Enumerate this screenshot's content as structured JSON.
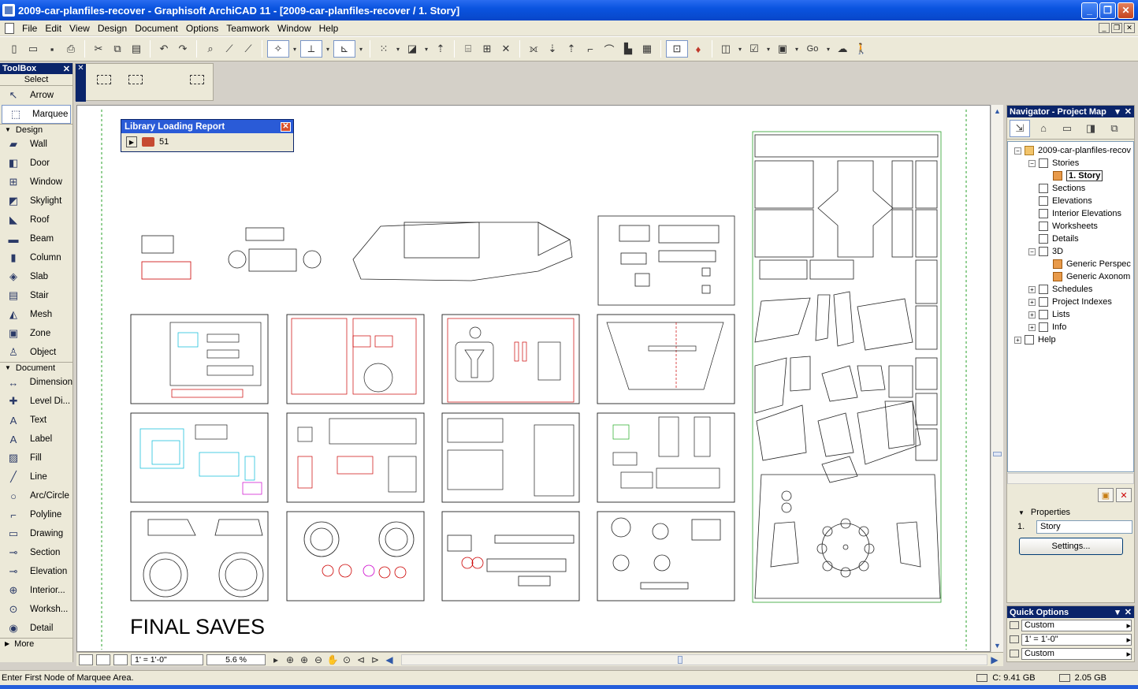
{
  "window": {
    "title": "2009-car-planfiles-recover - Graphisoft ArchiCAD 11 - [2009-car-planfiles-recover / 1. Story]",
    "min": "_",
    "max": "❐",
    "close": "✕"
  },
  "menu": [
    "File",
    "Edit",
    "View",
    "Design",
    "Document",
    "Options",
    "Teamwork",
    "Window",
    "Help"
  ],
  "toolbar": {
    "go_label": "Go"
  },
  "toolbox": {
    "title": "ToolBox",
    "close": "✕",
    "select_label": "Select",
    "select_tools": [
      {
        "label": "Arrow",
        "icon": "arrow-icon",
        "glyph": "↖"
      },
      {
        "label": "Marquee",
        "icon": "marquee-icon",
        "glyph": "⬚",
        "selected": true
      }
    ],
    "design_label": "Design",
    "design_tools": [
      {
        "label": "Wall",
        "icon": "wall-icon",
        "glyph": "▰"
      },
      {
        "label": "Door",
        "icon": "door-icon",
        "glyph": "◧"
      },
      {
        "label": "Window",
        "icon": "window-icon",
        "glyph": "⊞"
      },
      {
        "label": "Skylight",
        "icon": "skylight-icon",
        "glyph": "◩"
      },
      {
        "label": "Roof",
        "icon": "roof-icon",
        "glyph": "◣"
      },
      {
        "label": "Beam",
        "icon": "beam-icon",
        "glyph": "▬"
      },
      {
        "label": "Column",
        "icon": "column-icon",
        "glyph": "▮"
      },
      {
        "label": "Slab",
        "icon": "slab-icon",
        "glyph": "◈"
      },
      {
        "label": "Stair",
        "icon": "stair-icon",
        "glyph": "▤"
      },
      {
        "label": "Mesh",
        "icon": "mesh-icon",
        "glyph": "◭"
      },
      {
        "label": "Zone",
        "icon": "zone-icon",
        "glyph": "▣"
      },
      {
        "label": "Object",
        "icon": "object-icon",
        "glyph": "♙"
      }
    ],
    "document_label": "Document",
    "document_tools": [
      {
        "label": "Dimension",
        "icon": "dimension-icon",
        "glyph": "↔"
      },
      {
        "label": "Level Di...",
        "icon": "level-dimension-icon",
        "glyph": "✚"
      },
      {
        "label": "Text",
        "icon": "text-icon",
        "glyph": "A"
      },
      {
        "label": "Label",
        "icon": "label-icon",
        "glyph": "A"
      },
      {
        "label": "Fill",
        "icon": "fill-icon",
        "glyph": "▨"
      },
      {
        "label": "Line",
        "icon": "line-icon",
        "glyph": "╱"
      },
      {
        "label": "Arc/Circle",
        "icon": "arc-circle-icon",
        "glyph": "○"
      },
      {
        "label": "Polyline",
        "icon": "polyline-icon",
        "glyph": "⌐"
      },
      {
        "label": "Drawing",
        "icon": "drawing-icon",
        "glyph": "▭"
      },
      {
        "label": "Section",
        "icon": "section-icon",
        "glyph": "⊸"
      },
      {
        "label": "Elevation",
        "icon": "elevation-icon",
        "glyph": "⊸"
      },
      {
        "label": "Interior...",
        "icon": "interior-elevation-icon",
        "glyph": "⊕"
      },
      {
        "label": "Worksh...",
        "icon": "worksheet-icon",
        "glyph": "⊙"
      },
      {
        "label": "Detail",
        "icon": "detail-icon",
        "glyph": "◉"
      }
    ],
    "more_label": "More"
  },
  "library_report": {
    "title": "Library Loading Report",
    "count": "51"
  },
  "canvas": {
    "final_text": "FINAL SAVES"
  },
  "bottombar": {
    "scale": "1'    =    1'-0\"",
    "zoom": "5.6 %"
  },
  "status": {
    "message": "Enter First Node of Marquee Area.",
    "disk": "C: 9.41 GB",
    "memory": "2.05 GB"
  },
  "navigator": {
    "title": "Navigator - Project Map",
    "tree": [
      {
        "label": "2009-car-planfiles-recov",
        "level": 0,
        "pm": "−",
        "type": "folder"
      },
      {
        "label": "Stories",
        "level": 1,
        "pm": "−",
        "type": "plain"
      },
      {
        "label": "1. Story",
        "level": 2,
        "pm": "",
        "type": "story",
        "selected": true
      },
      {
        "label": "Sections",
        "level": 1,
        "pm": "",
        "type": "plain"
      },
      {
        "label": "Elevations",
        "level": 1,
        "pm": "",
        "type": "plain"
      },
      {
        "label": "Interior Elevations",
        "level": 1,
        "pm": "",
        "type": "plain"
      },
      {
        "label": "Worksheets",
        "level": 1,
        "pm": "",
        "type": "plain"
      },
      {
        "label": "Details",
        "level": 1,
        "pm": "",
        "type": "plain"
      },
      {
        "label": "3D",
        "level": 1,
        "pm": "−",
        "type": "plain"
      },
      {
        "label": "Generic Perspec",
        "level": 2,
        "pm": "",
        "type": "story"
      },
      {
        "label": "Generic Axonom",
        "level": 2,
        "pm": "",
        "type": "story"
      },
      {
        "label": "Schedules",
        "level": 1,
        "pm": "+",
        "type": "plain"
      },
      {
        "label": "Project Indexes",
        "level": 1,
        "pm": "+",
        "type": "plain"
      },
      {
        "label": "Lists",
        "level": 1,
        "pm": "+",
        "type": "plain"
      },
      {
        "label": "Info",
        "level": 1,
        "pm": "+",
        "type": "plain"
      },
      {
        "label": "Help",
        "level": 0,
        "pm": "+",
        "type": "plain"
      }
    ],
    "properties_label": "Properties",
    "prop_number": "1.",
    "prop_name": "Story",
    "settings_label": "Settings..."
  },
  "quick_options": {
    "title": "Quick Options",
    "rows": [
      "Custom",
      "1'    =    1'-0\"",
      "Custom"
    ]
  },
  "colors": {
    "title_blue": "#0a54e0",
    "palette_head": "#0a246a",
    "chrome": "#ece9d8",
    "drawing_red": "#cc0000",
    "drawing_cyan": "#00b8d8"
  }
}
